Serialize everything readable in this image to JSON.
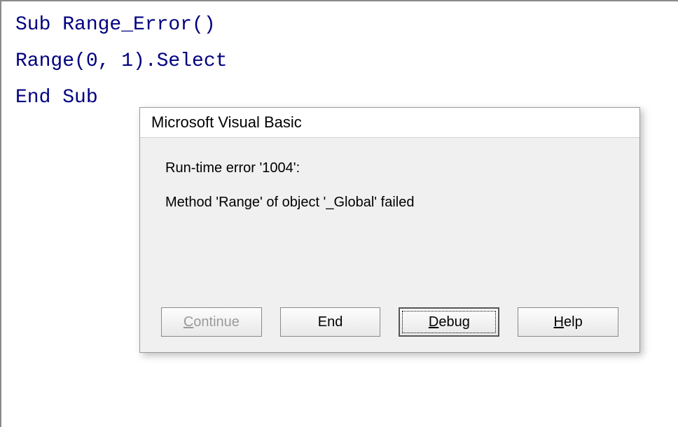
{
  "code": {
    "line1": "Sub Range_Error()",
    "line2": "",
    "line3": "Range(0, 1).Select",
    "line4": "",
    "line5": "End Sub"
  },
  "dialog": {
    "title": "Microsoft Visual Basic",
    "error_type": "Run-time error '1004':",
    "error_message": "Method 'Range' of object '_Global' failed",
    "buttons": {
      "continue_prefix": "C",
      "continue_rest": "ontinue",
      "end": "End",
      "debug_prefix": "D",
      "debug_rest": "ebug",
      "help_prefix": "H",
      "help_rest": "elp"
    }
  }
}
